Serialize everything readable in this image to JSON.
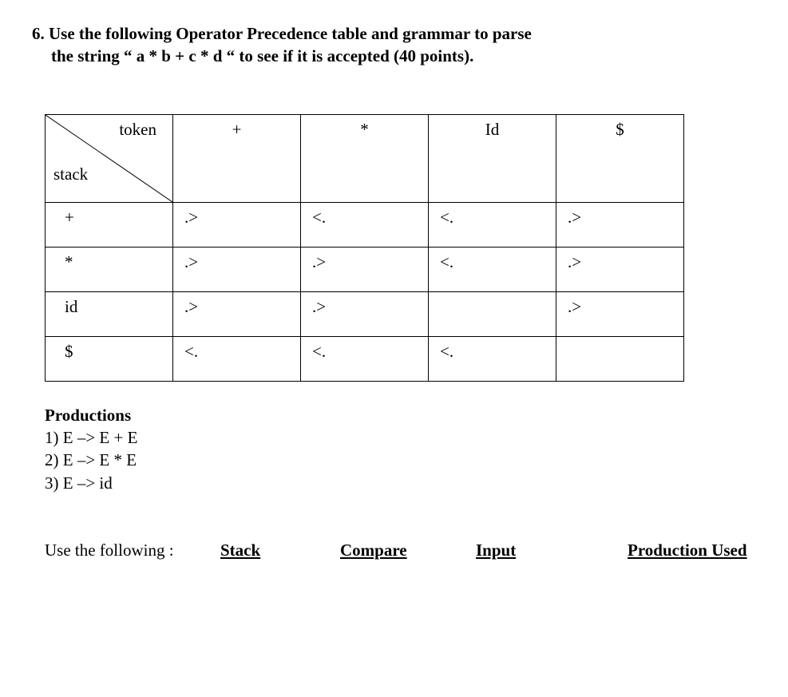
{
  "question": {
    "line1": "6. Use the following Operator Precedence table and grammar to parse",
    "line2": "the string  “ a * b + c * d “ to see if it is accepted  (40 points)."
  },
  "table": {
    "corner_top": "token",
    "corner_left": "stack",
    "col_headers": [
      "+",
      "*",
      "Id",
      "$"
    ],
    "rows": [
      {
        "label": "+",
        "cells": [
          ".>",
          "<.",
          "<.",
          ".>"
        ]
      },
      {
        "label": "*",
        "cells": [
          ".>",
          ".>",
          "<.",
          ".>"
        ]
      },
      {
        "label": "id",
        "cells": [
          ".>",
          ".>",
          "",
          ".>"
        ]
      },
      {
        "label": "$",
        "cells": [
          "<.",
          "<.",
          "<.",
          ""
        ]
      }
    ]
  },
  "productions": {
    "title": "Productions",
    "items": [
      "1) E –>    E + E",
      "2) E –>    E * E",
      "3) E –>    id"
    ]
  },
  "trace": {
    "lead": "Use  the following :",
    "columns": [
      "Stack",
      "Compare",
      "Input",
      "Production Used"
    ]
  }
}
